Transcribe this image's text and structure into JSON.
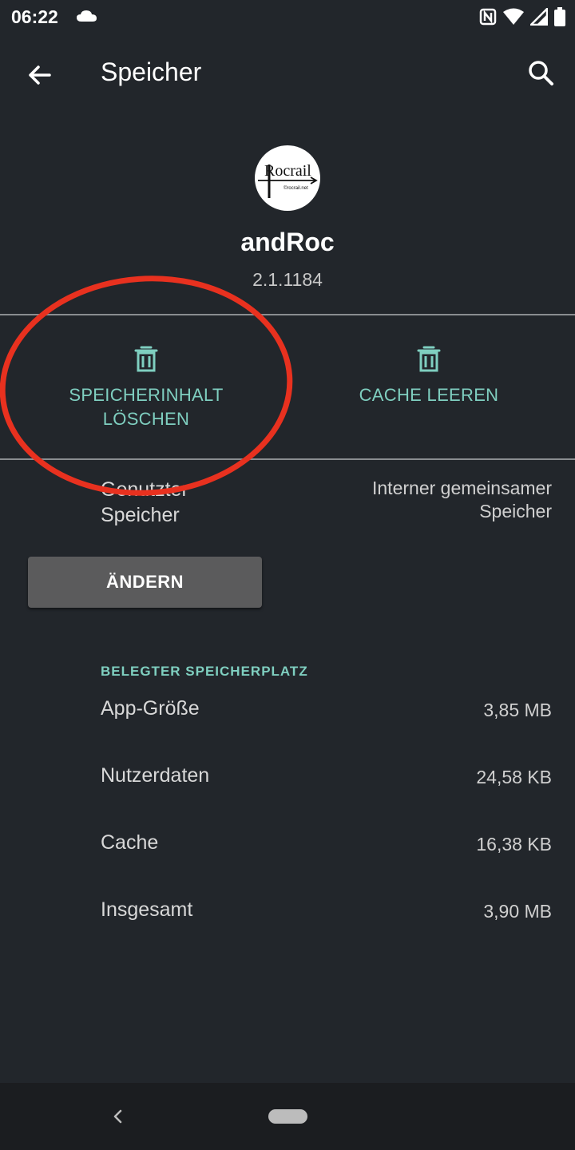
{
  "status_bar": {
    "time": "06:22",
    "icons": [
      "cloud-icon",
      "nfc-icon",
      "wifi-icon",
      "signal-icon",
      "battery-icon"
    ]
  },
  "app_bar": {
    "title": "Speicher",
    "back_icon": "arrow-back-icon",
    "search_icon": "search-icon"
  },
  "app_info": {
    "name": "andRoc",
    "version": "2.1.1184",
    "icon_text": "Rocrail",
    "icon_subtext": "©rocrail.net"
  },
  "actions": [
    {
      "label_line1": "SPEICHERINHALT",
      "label_line2": "LÖSCHEN",
      "icon": "trash-icon"
    },
    {
      "label_line1": "CACHE LEEREN",
      "icon": "trash-icon"
    }
  ],
  "storage": {
    "label_line1": "Genutzter",
    "label_line2": "Speicher",
    "value_line1": "Interner gemeinsamer",
    "value_line2": "Speicher",
    "change_button": "ÄNDERN"
  },
  "usage": {
    "header": "BELEGTER SPEICHERPLATZ",
    "rows": [
      {
        "label": "App-Größe",
        "value": "3,85 MB"
      },
      {
        "label": "Nutzerdaten",
        "value": "24,58 KB"
      },
      {
        "label": "Cache",
        "value": "16,38 KB"
      },
      {
        "label": "Insgesamt",
        "value": "3,90 MB"
      }
    ]
  },
  "colors": {
    "background": "#22262b",
    "accent": "#7fcfc0",
    "annotation": "#e8311f",
    "button": "#5b5b5c"
  }
}
